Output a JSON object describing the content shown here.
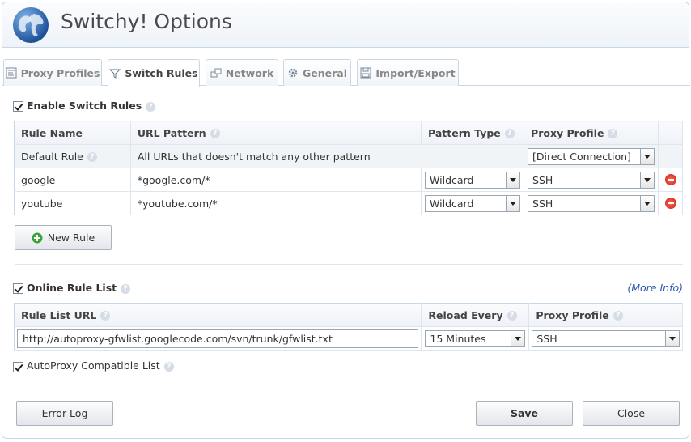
{
  "app": {
    "title": "Switchy! Options"
  },
  "tabs": [
    {
      "label": "Proxy Profiles",
      "icon": "proxy-profiles-icon",
      "active": false
    },
    {
      "label": "Switch Rules",
      "icon": "filter-icon",
      "active": true
    },
    {
      "label": "Network",
      "icon": "network-icon",
      "active": false
    },
    {
      "label": "General",
      "icon": "gear-icon",
      "active": false
    },
    {
      "label": "Import/Export",
      "icon": "floppy-icon",
      "active": false
    }
  ],
  "switch_rules": {
    "enable_label": "Enable Switch Rules",
    "enabled": true,
    "columns": [
      "Rule Name",
      "URL Pattern",
      "Pattern Type",
      "Proxy Profile"
    ],
    "default_rule": {
      "name": "Default Rule",
      "pattern": "All URLs that doesn't match any other pattern",
      "profile": "[Direct Connection]"
    },
    "rules": [
      {
        "name": "google",
        "pattern": "*google.com/*",
        "type": "Wildcard",
        "profile": "SSH"
      },
      {
        "name": "youtube",
        "pattern": "*youtube.com/*",
        "type": "Wildcard",
        "profile": "SSH"
      }
    ],
    "new_rule_label": "New Rule"
  },
  "online_list": {
    "label": "Online Rule List",
    "enabled": true,
    "more_info": "(More Info)",
    "columns": [
      "Rule List URL",
      "Reload Every",
      "Proxy Profile"
    ],
    "url": "http://autoproxy-gfwlist.googlecode.com/svn/trunk/gfwlist.txt",
    "reload": "15 Minutes",
    "profile": "SSH",
    "autoproxy_label": "AutoProxy Compatible List",
    "autoproxy_checked": true
  },
  "buttons": {
    "error_log": "Error Log",
    "save": "Save",
    "close": "Close"
  },
  "colors": {
    "accent": "#2a57b0",
    "border": "#c9d6e4",
    "remove": "#c91e12",
    "add": "#3aa33a"
  }
}
